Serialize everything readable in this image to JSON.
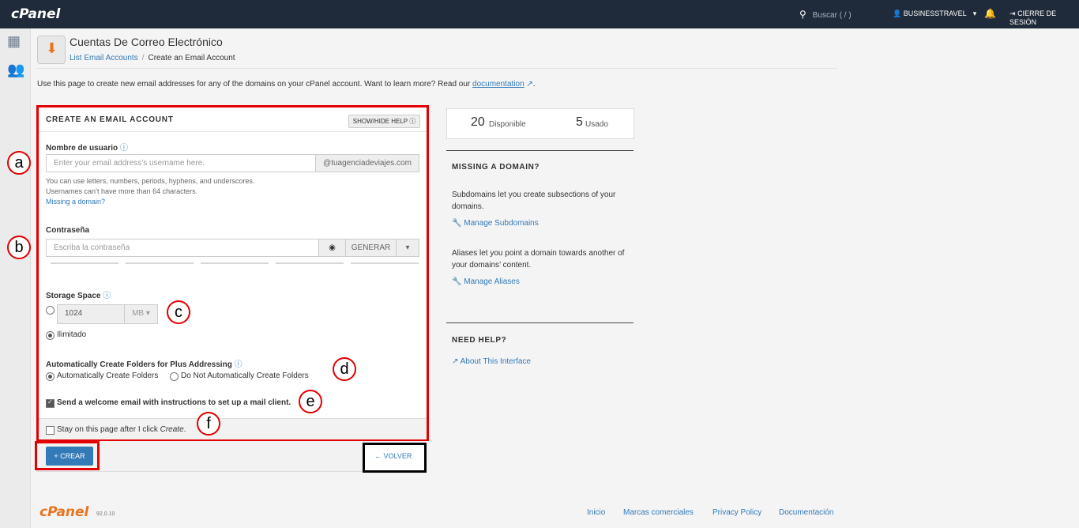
{
  "topbar": {
    "logo": "cPanel",
    "search_placeholder": "Buscar ( / )",
    "user": "BUSINESSTRAVEL",
    "logout": "CIERRE DE SESIÓN"
  },
  "page": {
    "title": "Cuentas De Correo Electrónico",
    "breadcrumb_link": "List Email Accounts",
    "breadcrumb_sep": "/",
    "breadcrumb_current": "Create an Email Account",
    "intro": "Use this page to create new email addresses for any of the domains on your cPanel account. Want to learn more? Read our",
    "intro_link": "documentation",
    "intro_end": "."
  },
  "form": {
    "title": "CREATE AN EMAIL ACCOUNT",
    "help_button": "SHOW/HIDE HELP",
    "username_label": "Nombre de usuario",
    "username_placeholder": "Enter your email address’s username here.",
    "domain_suffix": "@tuagenciadeviajes.com",
    "help_line1": "You can use letters, numbers, periods, hyphens, and underscores.",
    "help_line2": "Usernames can’t have more than 64 characters.",
    "missing_domain_link": "Missing a domain?",
    "password_label": "Contraseña",
    "password_placeholder": "Escriba la contraseña",
    "generate_button": "GENERAR",
    "storage_label": "Storage Space",
    "storage_value": "1024",
    "storage_unit": "MB",
    "unlimited_label": "Ilimitado",
    "plus_label": "Automatically Create Folders for Plus Addressing",
    "plus_auto": "Automatically Create Folders",
    "plus_no": "Do Not Automatically Create Folders",
    "welcome_label": "Send a welcome email with instructions to set up a mail client.",
    "stay_label": "Stay on this page after I click",
    "stay_label_em": "Create",
    "stay_label_end": ".",
    "create_button": "CREAR",
    "back_button": "VOLVER"
  },
  "markers": [
    "a",
    "b",
    "c",
    "d",
    "e",
    "f"
  ],
  "stats": {
    "available_num": "20",
    "available_label": "Disponible",
    "used_num": "5",
    "used_label": "Usado"
  },
  "right_panel": {
    "missing_title": "MISSING A DOMAIN?",
    "subdomains_text": "Subdomains let you create subsections of your domains.",
    "subdomains_link": "Manage Subdomains",
    "aliases_text": "Aliases let you point a domain towards another of your domains’ content.",
    "aliases_link": "Manage Aliases",
    "help_title": "NEED HELP?",
    "about_link": "About This Interface"
  },
  "footer": {
    "logo": "cPanel",
    "version": "92.0.10",
    "links": [
      "Inicio",
      "Marcas comerciales",
      "Privacy Policy",
      "Documentación"
    ]
  },
  "colors": {
    "topbar": "#1f2b3a",
    "accent": "#337ab7",
    "highlight_red": "#e20000",
    "brand_orange": "#e9741f"
  }
}
